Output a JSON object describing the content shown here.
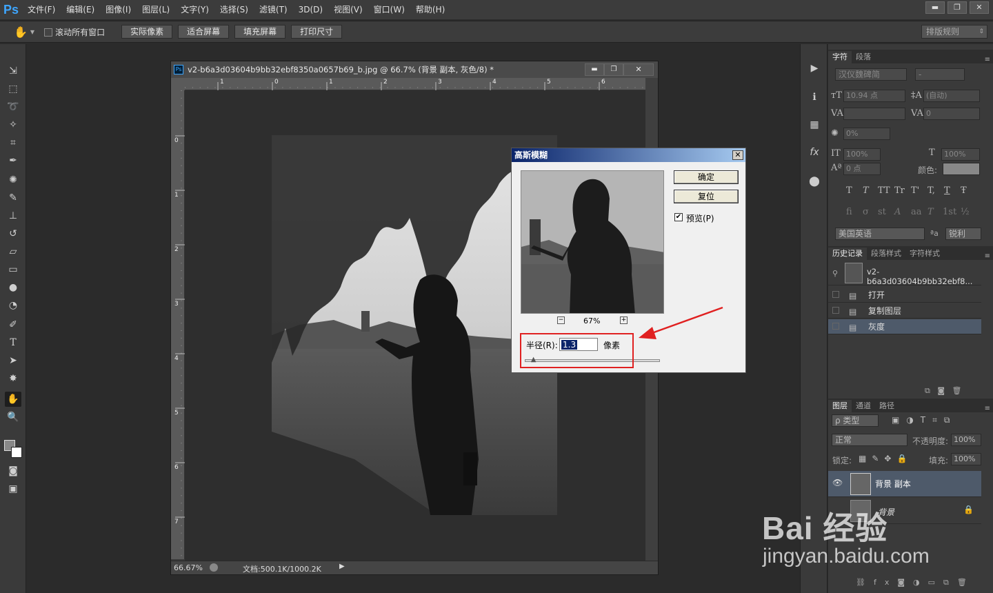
{
  "app": {
    "logo": "Ps"
  },
  "menu": [
    "文件(F)",
    "编辑(E)",
    "图像(I)",
    "图层(L)",
    "文字(Y)",
    "选择(S)",
    "滤镜(T)",
    "3D(D)",
    "视图(V)",
    "窗口(W)",
    "帮助(H)"
  ],
  "window_controls": {
    "minimize": "▬",
    "restore": "❐",
    "close": "✕"
  },
  "options": {
    "scroll_all": "滚动所有窗口",
    "actual_pixels": "实际像素",
    "fit_screen": "适合屏幕",
    "fill_screen": "填充屏幕",
    "print_size": "打印尺寸",
    "workspace": "排版规则"
  },
  "document": {
    "badge": "Ps",
    "title": "v2-b6a3d03604b9bb32ebf8350a0657b69_b.jpg @ 66.7% (背景 副本, 灰色/8) *",
    "zoom": "66.67%",
    "doc_info": "文档:500.1K/1000.2K",
    "ruler_h": [
      "1",
      "0",
      "1",
      "2",
      "3",
      "4",
      "5",
      "6"
    ],
    "ruler_v": [
      "0",
      "1",
      "2",
      "3",
      "4",
      "5",
      "6",
      "7"
    ]
  },
  "dialog": {
    "title": "高斯模糊",
    "ok": "确定",
    "reset": "复位",
    "preview_label": "预览(P)",
    "preview_checked": true,
    "zoom": "67%",
    "radius_label": "半径(R):",
    "radius_value": "1.3",
    "unit": "像素",
    "slider_fraction": 0.07
  },
  "character": {
    "tabs": [
      "字符",
      "段落"
    ],
    "font_family": "汉仪魏碑简",
    "font_style": "-",
    "size": "10.94 点",
    "leading": "(自动)",
    "kerning": "",
    "tracking": "0",
    "scale_pct": "0%",
    "vscale": "100%",
    "hscale": "100%",
    "baseline": "0 点",
    "color_label": "颜色:",
    "language": "美国英语",
    "aa_symbol": "ªa",
    "antialias": "锐利",
    "styles": [
      "T",
      "T",
      "TT",
      "Tr",
      "T'",
      "T,",
      "T",
      "Ŧ"
    ],
    "features": [
      "fi",
      "σ",
      "st",
      "A",
      "aa",
      "T",
      "1st",
      "½"
    ]
  },
  "history": {
    "tabs": [
      "历史记录",
      "段落样式",
      "字符样式"
    ],
    "snapshot": "v2-b6a3d03604b9bb32ebf8...",
    "items": [
      "打开",
      "复制图层",
      "灰度"
    ]
  },
  "layers": {
    "tabs": [
      "图层",
      "通道",
      "路径"
    ],
    "filter": "ρ 类型",
    "blend": "正常",
    "opacity_label": "不透明度:",
    "opacity": "100%",
    "lock_label": "锁定:",
    "fill_label": "填充:",
    "fill": "100%",
    "items": [
      "背景 副本",
      "背景"
    ]
  },
  "watermark": {
    "brand": "Bai  经验",
    "url": "jingyan.baidu.com"
  },
  "colors": {
    "accent": "#3ea6ff",
    "dialog_title_left": "#0a246a",
    "highlight": "#e02020",
    "selected_row": "#4e5a6a"
  }
}
